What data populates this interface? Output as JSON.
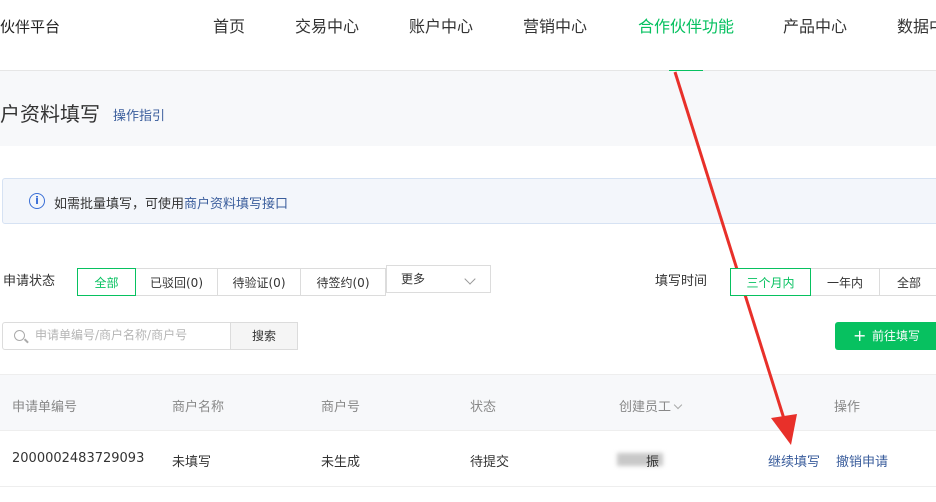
{
  "header": {
    "brand": "伙伴平台",
    "nav": [
      {
        "label": "首页"
      },
      {
        "label": "交易中心"
      },
      {
        "label": "账户中心"
      },
      {
        "label": "营销中心"
      },
      {
        "label": "合作伙伴功能",
        "active": true
      },
      {
        "label": "产品中心"
      },
      {
        "label": "数据中"
      }
    ]
  },
  "page": {
    "title": "户资料填写",
    "guide_link": "操作指引"
  },
  "notice": {
    "text": "如需批量填写，可使用",
    "link": "商户资料填写接口"
  },
  "filters": {
    "status_label": "申请状态",
    "status_options": [
      "全部",
      "已驳回(0)",
      "待验证(0)",
      "待签约(0)"
    ],
    "status_selected": "全部",
    "more_label": "更多",
    "time_label": "填写时间",
    "time_options": [
      "三个月内",
      "一年内",
      "全部"
    ],
    "time_selected": "三个月内"
  },
  "search": {
    "placeholder": "申请单编号/商户名称/商户号",
    "value": "",
    "button": "搜索"
  },
  "go_button": "前往填写",
  "table": {
    "columns": [
      "申请单编号",
      "商户名称",
      "商户号",
      "状态",
      "创建员工",
      "操作"
    ],
    "rows": [
      {
        "application_no": "2000002483729093",
        "merchant_name": "未填写",
        "merchant_no": "未生成",
        "status": "待提交",
        "creator_visible": "振",
        "actions": [
          "继续填写",
          "撤销申请"
        ]
      }
    ]
  },
  "colors": {
    "accent": "#07c160",
    "link": "#3a5d9c",
    "annotation_arrow": "#e8302a"
  },
  "annotation": {
    "type": "arrow",
    "target": "继续填写"
  }
}
